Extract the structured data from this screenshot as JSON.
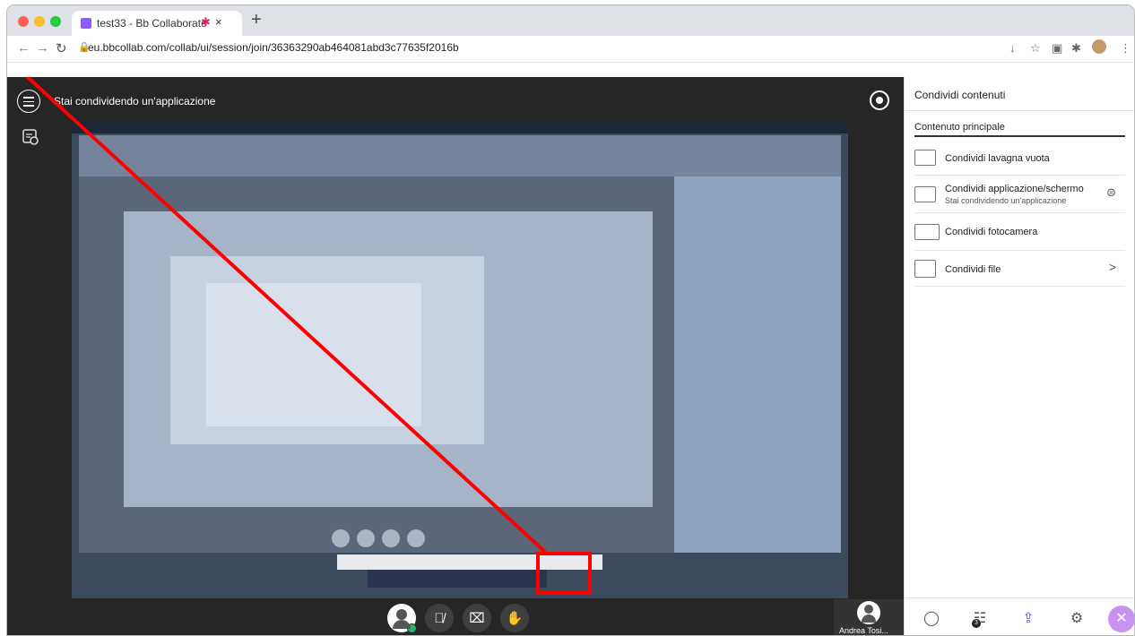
{
  "browser": {
    "tab_title": "test33 - Bb Collaborate",
    "url": "eu.bbcollab.com/collab/ui/session/join/36363290ab464081abd3c77635f2016b",
    "new_tab_symbol": "+",
    "close_symbol": "×"
  },
  "session": {
    "share_status": "Stai condividendo un'applicazione",
    "participant_name": "Andrea Tosi..."
  },
  "panel": {
    "title": "Condividi contenuti",
    "section_title": "Contenuto principale",
    "options": [
      {
        "label": "Condividi lavagna vuota",
        "sub": ""
      },
      {
        "label": "Condividi applicazione/schermo",
        "sub": "Stai condividendo un'applicazione"
      },
      {
        "label": "Condividi fotocamera",
        "sub": ""
      },
      {
        "label": "Condividi file",
        "sub": ""
      }
    ],
    "chevron": ">",
    "attendee_count": "3"
  },
  "colors": {
    "accent": "#7e50c7",
    "close_button": "#c893f0",
    "annotation": "#ff0000",
    "status_online": "#2bb673"
  }
}
